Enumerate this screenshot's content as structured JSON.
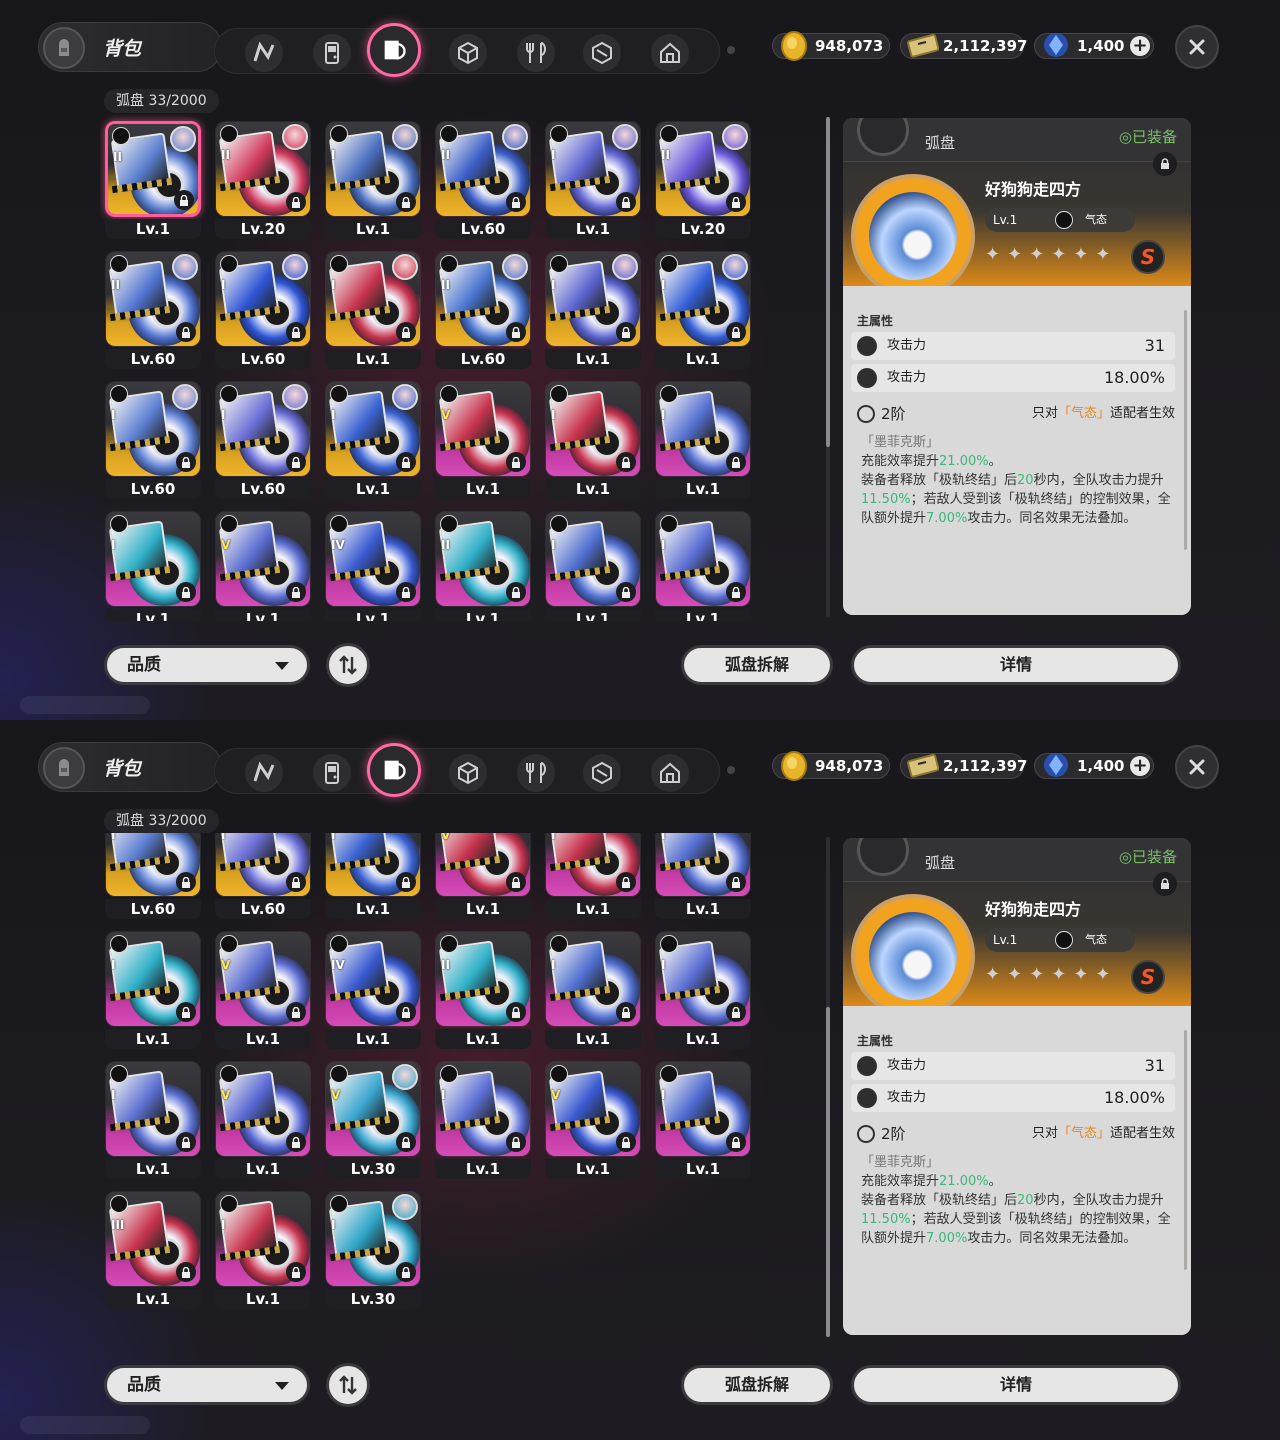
{
  "header": {
    "bag_title": "背包",
    "tabs": [
      {
        "icon": "n-logo-icon"
      },
      {
        "icon": "handheld-device-icon"
      },
      {
        "icon": "drive-disc-icon",
        "active": true
      },
      {
        "icon": "cube-icon"
      },
      {
        "icon": "utensils-icon"
      },
      {
        "icon": "box-shield-icon"
      },
      {
        "icon": "house-icon"
      }
    ],
    "currencies": [
      {
        "icon": "gold-coin-icon",
        "value": "948,073"
      },
      {
        "icon": "ticket-icon",
        "value": "2,112,397"
      },
      {
        "icon": "blue-crystal-icon",
        "value": "1,400"
      }
    ]
  },
  "grid": {
    "title": "弧盘  33/2000"
  },
  "disc_items": [
    {
      "lv": "Lv.1",
      "q": "S",
      "tier": "II",
      "color": "#5a7fcf"
    },
    {
      "lv": "Lv.20",
      "q": "S",
      "tier": "II",
      "color": "#d23a5c"
    },
    {
      "lv": "Lv.1",
      "q": "S",
      "tier": "I",
      "color": "#4a6fc0"
    },
    {
      "lv": "Lv.60",
      "q": "S",
      "tier": "II",
      "color": "#3b5fc8"
    },
    {
      "lv": "Lv.1",
      "q": "S",
      "tier": "I",
      "color": "#5f66d2"
    },
    {
      "lv": "Lv.20",
      "q": "S",
      "tier": "II",
      "color": "#6a58d8"
    },
    {
      "lv": "Lv.60",
      "q": "S",
      "tier": "II",
      "color": "#4f73cf"
    },
    {
      "lv": "Lv.60",
      "q": "S",
      "tier": "I",
      "color": "#2e55d6"
    },
    {
      "lv": "Lv.1",
      "q": "S",
      "tier": "I",
      "color": "#c8344e"
    },
    {
      "lv": "Lv.60",
      "q": "S",
      "tier": "II",
      "color": "#4a76d0"
    },
    {
      "lv": "Lv.1",
      "q": "S",
      "tier": "I",
      "color": "#5a64cf"
    },
    {
      "lv": "Lv.1",
      "q": "S",
      "tier": "I",
      "color": "#3360d8"
    },
    {
      "lv": "Lv.60",
      "q": "S",
      "tier": "I",
      "color": "#5c7fd2"
    },
    {
      "lv": "Lv.60",
      "q": "S",
      "tier": "I",
      "color": "#6b6fd6"
    },
    {
      "lv": "Lv.1",
      "q": "S",
      "tier": "I",
      "color": "#3a63d2"
    },
    {
      "lv": "Lv.1",
      "q": "A",
      "tier": "V",
      "color": "#c8344e"
    },
    {
      "lv": "Lv.1",
      "q": "A",
      "tier": "I",
      "color": "#c8344e"
    },
    {
      "lv": "Lv.1",
      "q": "A",
      "tier": "I",
      "color": "#5570d2"
    },
    {
      "lv": "Lv.1",
      "q": "A",
      "tier": "I",
      "color": "#2fb0c8"
    },
    {
      "lv": "Lv.1",
      "q": "A",
      "tier": "V",
      "color": "#5a6cd0"
    },
    {
      "lv": "Lv.1",
      "q": "A",
      "tier": "IV",
      "color": "#3a5bd2"
    },
    {
      "lv": "Lv.1",
      "q": "A",
      "tier": "II",
      "color": "#2fb0c8"
    },
    {
      "lv": "Lv.1",
      "q": "A",
      "tier": "I",
      "color": "#4f6fd0"
    },
    {
      "lv": "Lv.1",
      "q": "A",
      "tier": "I",
      "color": "#5b6fd4"
    },
    {
      "lv": "Lv.1",
      "q": "A",
      "tier": "I",
      "color": "#5a6fd0"
    },
    {
      "lv": "Lv.1",
      "q": "A",
      "tier": "V",
      "color": "#5566d2"
    },
    {
      "lv": "Lv.30",
      "q": "A",
      "tier": "V",
      "color": "#3aa6cf"
    },
    {
      "lv": "Lv.1",
      "q": "A",
      "tier": "I",
      "color": "#5b6fd4"
    },
    {
      "lv": "Lv.1",
      "q": "A",
      "tier": "V",
      "color": "#3a5ad2"
    },
    {
      "lv": "Lv.1",
      "q": "A",
      "tier": "I",
      "color": "#4c68d0"
    },
    {
      "lv": "Lv.1",
      "q": "A",
      "tier": "III",
      "color": "#c8344e"
    },
    {
      "lv": "Lv.1",
      "q": "A",
      "tier": "I",
      "color": "#c8344e"
    },
    {
      "lv": "Lv.30",
      "q": "A",
      "tier": "I",
      "color": "#2fa6c8"
    }
  ],
  "detail": {
    "category": "弧盘",
    "equipped": "◎已装备",
    "name": "好狗狗走四方",
    "level": "Lv.1",
    "attribute": "气态",
    "stars": "✦✦✦✦✦✦",
    "rank": "S",
    "main_attr_label": "主属性",
    "stats": [
      {
        "name": "攻击力",
        "value": "31"
      },
      {
        "name": "攻击力",
        "value": "18.00%"
      }
    ],
    "set_tier": "2阶",
    "set_condition_pre": "只对",
    "set_condition_hl": "「气态」",
    "set_condition_post": "适配者生效",
    "set_name": "「墨菲克斯」",
    "desc_1a": "充能效率提升",
    "desc_1b": "21.00%",
    "desc_1c": "。",
    "desc_2a": "装备者释放「极轨终结」后",
    "desc_2b": "20",
    "desc_2c": "秒内，全队攻击力提升",
    "desc_2d": "11.50%",
    "desc_2e": "；若敌人受到该「极轨终结」的控制效果，全队额外提升",
    "desc_2f": "7.00%",
    "desc_2g": "攻击力。同名效果无法叠加。"
  },
  "footer": {
    "filter_label": "品质",
    "disassemble_label": "弧盘拆解",
    "details_label": "详情"
  },
  "colors": {
    "accent_pink": "#ff6aa4",
    "quality_s": "#f0b42a",
    "quality_a": "#d64cb8",
    "highlight_green": "#38b87a",
    "highlight_orange": "#e8841a"
  }
}
